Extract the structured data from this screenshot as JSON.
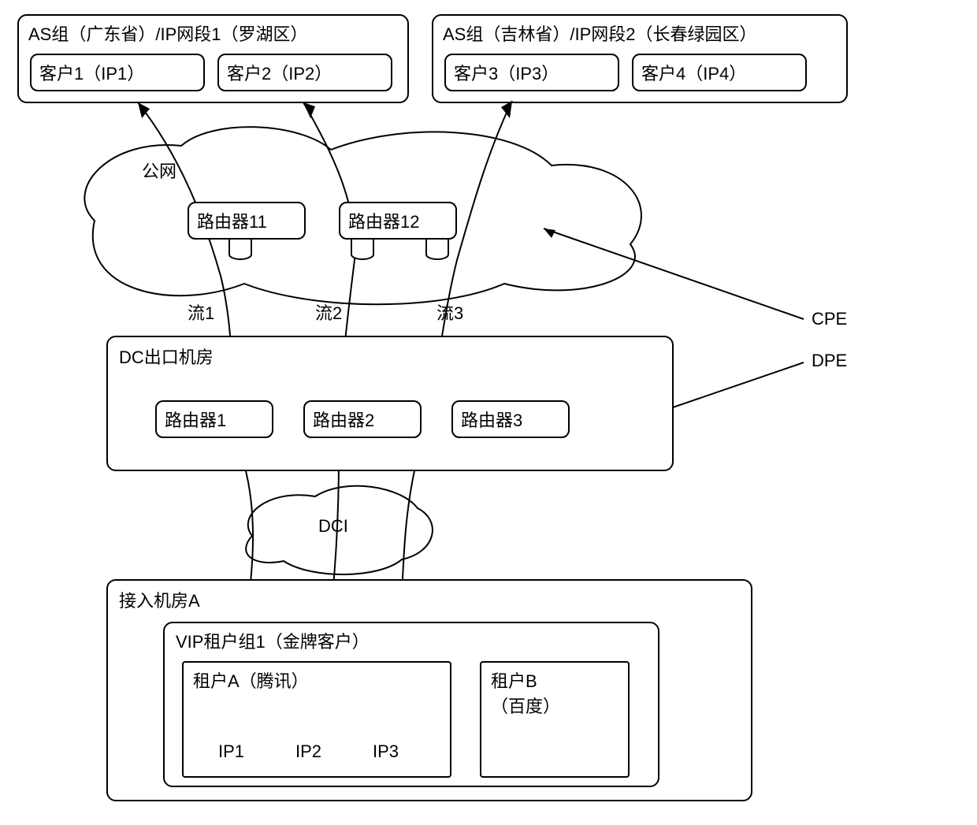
{
  "topGroups": [
    {
      "header": "AS组（广东省）/IP网段1（罗湖区）",
      "clients": [
        "客户1（IP1）",
        "客户2（IP2）"
      ]
    },
    {
      "header": "AS组（吉林省）/IP网段2（长春绿园区）",
      "clients": [
        "客户3（IP3）",
        "客户4（IP4）"
      ]
    }
  ],
  "publicNet": {
    "label": "公网",
    "routers": [
      "路由器11",
      "路由器12"
    ]
  },
  "flows": [
    "流1",
    "流2",
    "流3"
  ],
  "cpe": "CPE",
  "dpe": "DPE",
  "dcExit": {
    "label": "DC出口机房",
    "routers": [
      "路由器1",
      "路由器2",
      "路由器3"
    ]
  },
  "dci": "DCI",
  "accessRoom": {
    "label": "接入机房A",
    "vipGroup": {
      "label": "VIP租户组1（金牌客户）",
      "tenants": [
        {
          "name": "租户A（腾讯）",
          "ips": [
            "IP1",
            "IP2",
            "IP3"
          ]
        },
        {
          "name": "租户B\n（百度）"
        }
      ]
    }
  }
}
